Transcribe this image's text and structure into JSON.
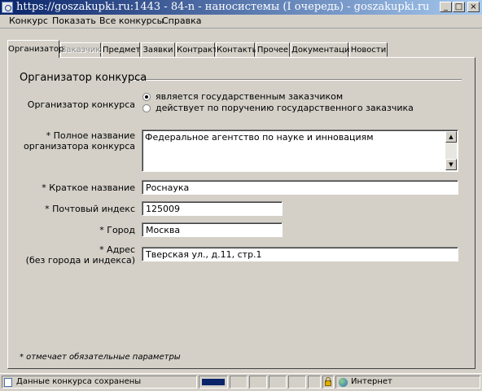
{
  "window": {
    "title": "https://goszakupki.ru:1443 - 84-n - наносистемы (I очередь) - goszakupki.ru - Micro...",
    "buttons": [
      "_",
      "□",
      "×"
    ]
  },
  "menu": [
    "Конкурс",
    "Показать",
    "Все конкурсы",
    "Справка"
  ],
  "tabs": [
    {
      "label": "Организатор",
      "state": "active"
    },
    {
      "label": "Заказчик",
      "state": "disabled"
    },
    {
      "label": "Предмет",
      "state": "normal"
    },
    {
      "label": "Заявки",
      "state": "normal"
    },
    {
      "label": "Контракт",
      "state": "normal"
    },
    {
      "label": "Контакты",
      "state": "normal"
    },
    {
      "label": "Прочее",
      "state": "normal"
    },
    {
      "label": "Документация",
      "state": "normal"
    },
    {
      "label": "Новости",
      "state": "normal"
    }
  ],
  "section": {
    "title": "Организатор конкурса"
  },
  "form": {
    "organizer_label": "Организатор конкурса",
    "radio_options": [
      {
        "label": "является государственным заказчиком",
        "checked": true
      },
      {
        "label": "действует по поручению государственного заказчика",
        "checked": false
      }
    ],
    "full_name_label_1": "* Полное название",
    "full_name_label_2": "организатора конкурса",
    "full_name_value": "Федеральное агентство по науке и инновациям",
    "short_name_label": "* Краткое название",
    "short_name_value": "Роснаука",
    "postal_label": "* Почтовый индекс",
    "postal_value": "125009",
    "city_label": "* Город",
    "city_value": "Москва",
    "address_label_1": "* Адрес",
    "address_label_2": "(без города и индекса)",
    "address_value": "Тверская ул., д.11, стр.1"
  },
  "footnote": "* отмечает обязательные параметры",
  "statusbar": {
    "message": "Данные конкурса сохранены",
    "zone": "Интернет",
    "icons": [
      "page-icon",
      "lock-icon",
      "globe-icon"
    ]
  }
}
